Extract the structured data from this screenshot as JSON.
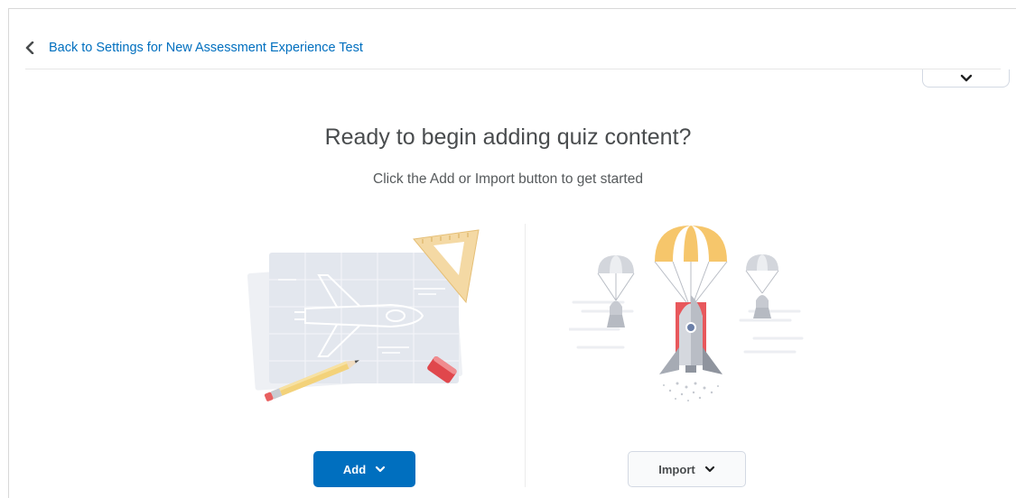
{
  "nav": {
    "back_label": "Back to Settings for New Assessment Experience Test",
    "back_icon": "chevron-left-icon",
    "collapse_icon": "chevron-down-icon"
  },
  "empty_state": {
    "title": "Ready to begin adding quiz content?",
    "subtitle": "Click the Add or Import button to get started"
  },
  "actions": {
    "add_label": "Add",
    "import_label": "Import",
    "caret_icon": "chevron-down-icon"
  },
  "colors": {
    "primary": "#006fbf",
    "text": "#494c4e",
    "border": "#d3d9e3"
  }
}
